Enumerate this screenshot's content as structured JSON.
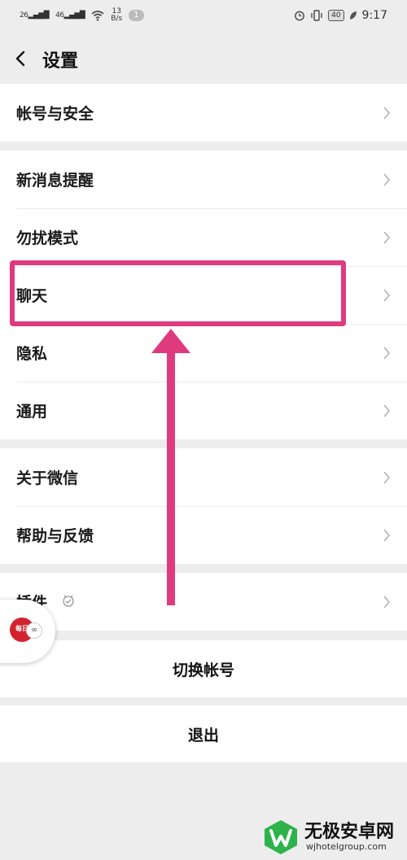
{
  "status_bar": {
    "signal_1": "26",
    "signal_2": "46",
    "speed_value": "13",
    "speed_unit": "B/s",
    "notification_count": "1",
    "battery": "40",
    "time": "9:17"
  },
  "header": {
    "title": "设置"
  },
  "settings": {
    "account_security": "帐号与安全",
    "new_message_alert": "新消息提醒",
    "do_not_disturb": "勿扰模式",
    "chat": "聊天",
    "privacy": "隐私",
    "general": "通用",
    "about_wechat": "关于微信",
    "help_feedback": "帮助与反馈",
    "plugins": "插件"
  },
  "actions": {
    "switch_account": "切换帐号",
    "logout": "退出"
  },
  "floating_widget": {
    "label": "每日"
  },
  "watermark": {
    "title": "无极安卓网",
    "url": "wjhotelgroup.com"
  },
  "colors": {
    "highlight": "#e03a7f",
    "background": "#ededed",
    "watermark_green": "#2db34a"
  }
}
